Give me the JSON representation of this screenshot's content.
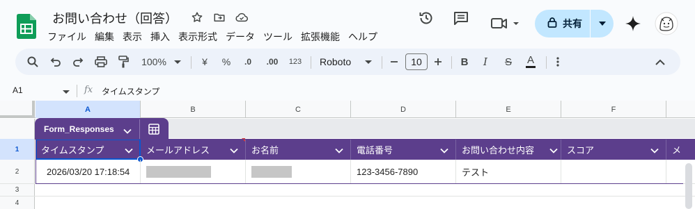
{
  "document": {
    "title": "お問い合わせ（回答）"
  },
  "menu": [
    "ファイル",
    "編集",
    "表示",
    "挿入",
    "表示形式",
    "データ",
    "ツール",
    "拡張機能",
    "ヘルプ"
  ],
  "header": {
    "share_label": "共有"
  },
  "toolbar": {
    "zoom": "100%",
    "currency": "¥",
    "percent": "%",
    "decrease_decimal": ".0",
    "increase_decimal": ".00",
    "number_format": "123",
    "font": "Roboto",
    "font_size": "10",
    "bold": "B",
    "italic": "I",
    "strikethrough": "S",
    "text_color": "A"
  },
  "formula_bar": {
    "cell_ref": "A1",
    "fx": "fx",
    "value": "タイムスタンプ"
  },
  "grid": {
    "columns": [
      "A",
      "B",
      "C",
      "D",
      "E",
      "F"
    ],
    "row_numbers": [
      "1",
      "2",
      "3",
      "4"
    ],
    "table_name": "Form_Responses",
    "headers": [
      "タイムスタンプ",
      "メールアドレス",
      "お名前",
      "電話番号",
      "お問い合わせ内容",
      "スコア",
      "メ"
    ],
    "row2": {
      "timestamp": "2026/03/20 17:18:54",
      "phone": "123-3456-7890",
      "inquiry": "テスト"
    }
  },
  "colors": {
    "accent": "#0b57d0",
    "table_header": "#5c3e8c",
    "share_bg": "#c2e7ff",
    "app_green": "#0f9d58"
  }
}
